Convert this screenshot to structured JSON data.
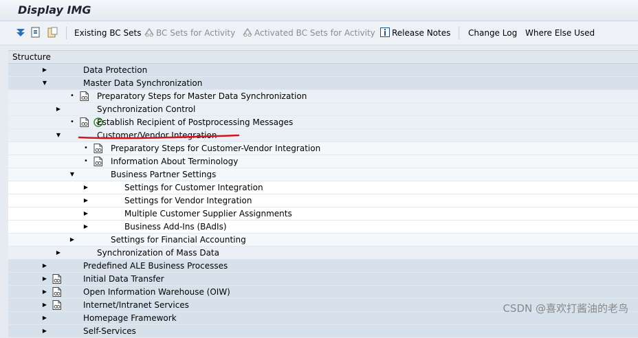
{
  "window": {
    "title": "Display IMG"
  },
  "toolbar": {
    "items": [
      {
        "label": "Existing BC Sets",
        "disabled": false
      },
      {
        "label": "BC Sets for Activity",
        "disabled": true
      },
      {
        "label": "Activated BC Sets for Activity",
        "disabled": true
      },
      {
        "label": "Release Notes",
        "disabled": false
      },
      {
        "label": "Change Log",
        "disabled": false
      },
      {
        "label": "Where Else Used",
        "disabled": false
      }
    ]
  },
  "structure": {
    "header": "Structure",
    "rows": [
      {
        "label": "Data Protection",
        "level": 0,
        "expander": "collapsed",
        "doc": false,
        "act": false
      },
      {
        "label": "Master Data Synchronization",
        "level": 0,
        "expander": "expanded",
        "doc": false,
        "act": false
      },
      {
        "label": "Preparatory Steps for Master Data Synchronization",
        "level": 1,
        "expander": "leaf",
        "doc": true,
        "act": false
      },
      {
        "label": "Synchronization Control",
        "level": 1,
        "expander": "collapsed",
        "doc": false,
        "act": false
      },
      {
        "label": "Establish Recipient of Postprocessing Messages",
        "level": 1,
        "expander": "leaf",
        "doc": true,
        "act": true
      },
      {
        "label": "Customer/Vendor Integration",
        "level": 1,
        "expander": "expanded",
        "doc": false,
        "act": false
      },
      {
        "label": "Preparatory Steps for Customer-Vendor Integration",
        "level": 2,
        "expander": "leaf",
        "doc": true,
        "act": false
      },
      {
        "label": "Information About Terminology",
        "level": 2,
        "expander": "leaf",
        "doc": true,
        "act": false
      },
      {
        "label": "Business Partner Settings",
        "level": 2,
        "expander": "expanded",
        "doc": false,
        "act": false
      },
      {
        "label": "Settings for Customer Integration",
        "level": 3,
        "expander": "collapsed",
        "doc": false,
        "act": false
      },
      {
        "label": "Settings for Vendor Integration",
        "level": 3,
        "expander": "collapsed",
        "doc": false,
        "act": false
      },
      {
        "label": "Multiple Customer Supplier Assignments",
        "level": 3,
        "expander": "collapsed",
        "doc": false,
        "act": false
      },
      {
        "label": "Business Add-Ins (BAdIs)",
        "level": 3,
        "expander": "collapsed",
        "doc": false,
        "act": false
      },
      {
        "label": "Settings for Financial Accounting",
        "level": 2,
        "expander": "collapsed",
        "doc": false,
        "act": false
      },
      {
        "label": "Synchronization of Mass Data",
        "level": 1,
        "expander": "collapsed",
        "doc": false,
        "act": false
      },
      {
        "label": "Predefined ALE Business Processes",
        "level": 0,
        "expander": "collapsed",
        "doc": false,
        "act": false
      },
      {
        "label": "Initial Data Transfer",
        "level": 0,
        "expander": "collapsed",
        "doc": true,
        "act": false
      },
      {
        "label": "Open Information Warehouse (OIW)",
        "level": 0,
        "expander": "collapsed",
        "doc": true,
        "act": false
      },
      {
        "label": "Internet/Intranet Services",
        "level": 0,
        "expander": "collapsed",
        "doc": true,
        "act": false
      },
      {
        "label": "Homepage Framework",
        "level": 0,
        "expander": "collapsed",
        "doc": false,
        "act": false
      },
      {
        "label": "Self-Services",
        "level": 0,
        "expander": "collapsed",
        "doc": false,
        "act": false
      }
    ]
  },
  "watermark": "CSDN @喜欢打酱油的老鸟",
  "colors": {
    "annotation": "#d2141c",
    "activity_icon": "#2f8a2f"
  }
}
